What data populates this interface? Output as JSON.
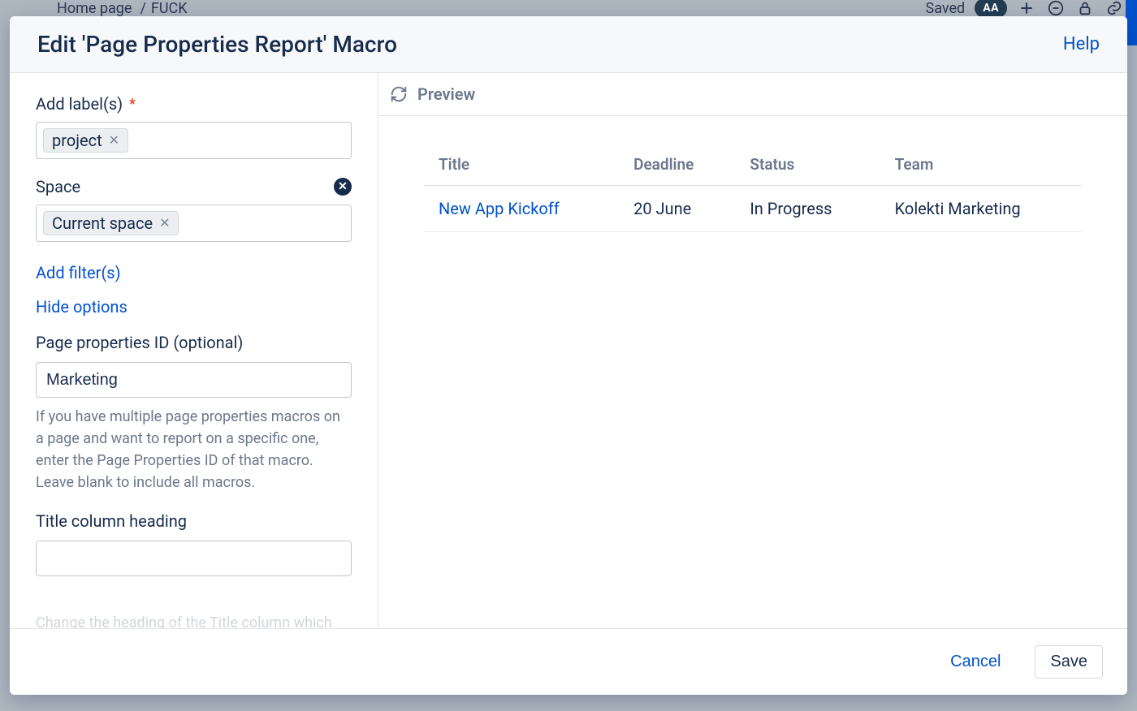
{
  "backdrop": {
    "breadcrumb_1": "Home page",
    "breadcrumb_sep": "/",
    "breadcrumb_2": "FUCK",
    "saved_label": "Saved",
    "aa_badge": "AA"
  },
  "dialog": {
    "title": "Edit 'Page Properties Report' Macro",
    "help": "Help"
  },
  "form": {
    "labels_label": "Add label(s)",
    "labels_required_mark": "*",
    "label_chip": "project",
    "space_label": "Space",
    "space_chip": "Current space",
    "add_filters": "Add filter(s)",
    "hide_options": "Hide options",
    "pp_id_label": "Page properties ID (optional)",
    "pp_id_value": "Marketing",
    "pp_id_help": "If you have multiple page properties macros on a page and want to report on a specific one, enter the Page Properties ID of that macro. Leave blank to include all macros.",
    "title_col_label": "Title column heading",
    "title_col_value": ""
  },
  "preview": {
    "heading": "Preview",
    "columns": [
      "Title",
      "Deadline",
      "Status",
      "Team"
    ],
    "rows": [
      {
        "title": "New App Kickoff",
        "deadline": "20 June",
        "status": "In Progress",
        "team": "Kolekti Marketing"
      }
    ]
  },
  "footer": {
    "cancel": "Cancel",
    "save": "Save"
  }
}
